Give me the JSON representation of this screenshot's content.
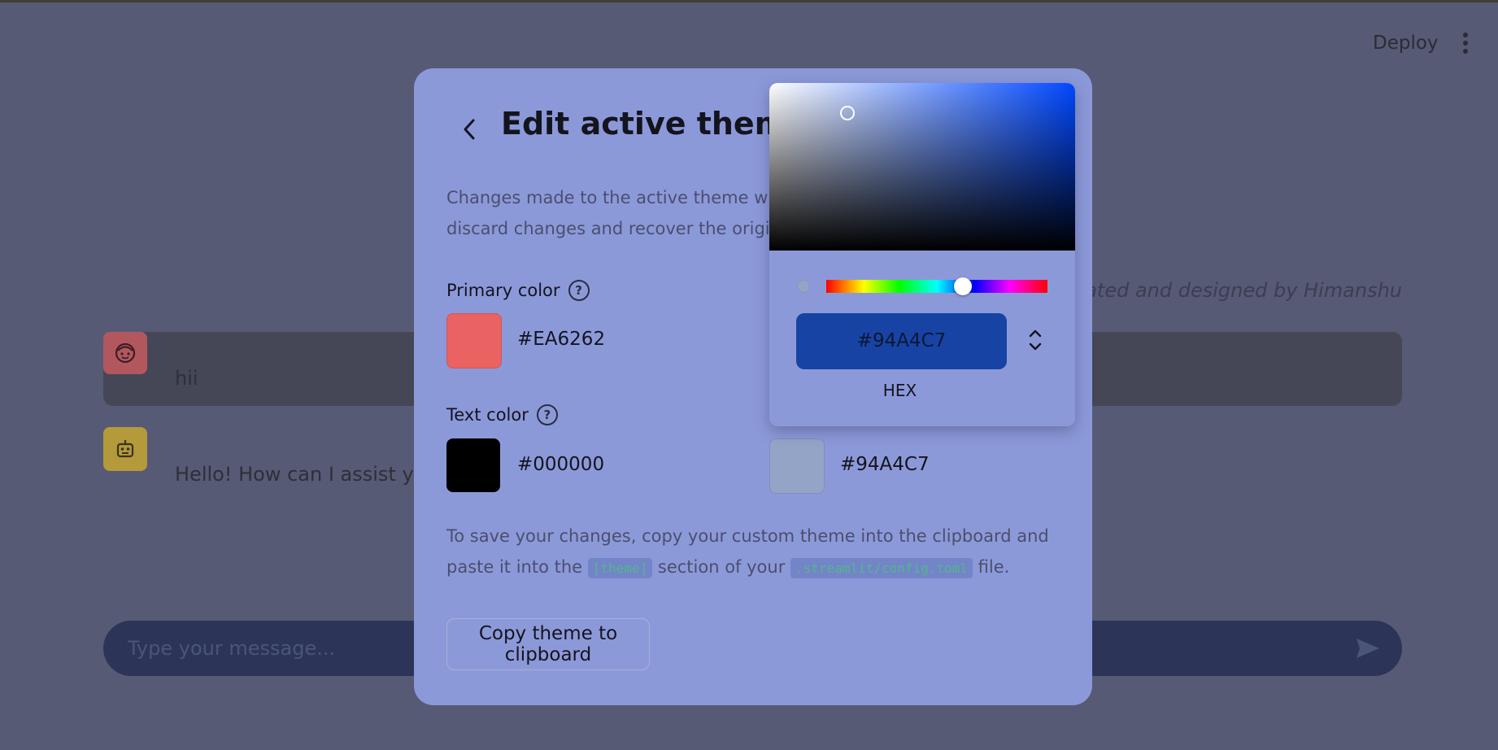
{
  "header": {
    "deploy_label": "Deploy"
  },
  "credit": "Created and designed by Himanshu",
  "chat": {
    "messages": [
      {
        "role": "user",
        "text": "hii"
      },
      {
        "role": "assistant",
        "text": "Hello! How can I assist you"
      }
    ],
    "input_placeholder": "Type your message..."
  },
  "modal": {
    "title": "Edit active theme",
    "description_line1": "Changes made to the active theme will ex",
    "description_line2": "discard changes and recover the original",
    "primary_color": {
      "label": "Primary color",
      "value": "#EA6262",
      "swatch": "#EA6262"
    },
    "text_color": {
      "label": "Text color",
      "value": "#000000",
      "swatch": "#000000"
    },
    "secondary_value": {
      "value": "#94A4C7",
      "swatch": "#94A4C7"
    },
    "save_note_part1": "To save your changes, copy your custom theme into the clipboard and paste it into the",
    "save_note_code1": "[theme]",
    "save_note_part2": "section of your",
    "save_note_code2": ".streamlit/config.toml",
    "save_note_part3": "file.",
    "copy_button": "Copy theme to clipboard"
  },
  "color_picker": {
    "hex_value": "#94A4C7",
    "mode_label": "HEX",
    "hue_color": "#0047ff"
  },
  "icons": {
    "back": "chevron-left-icon",
    "help": "question-circle-icon",
    "send": "send-icon",
    "user_avatar": "face-icon",
    "bot_avatar": "robot-icon",
    "menu": "kebab-menu-icon",
    "mode_toggle": "up-down-chevron-icon"
  }
}
